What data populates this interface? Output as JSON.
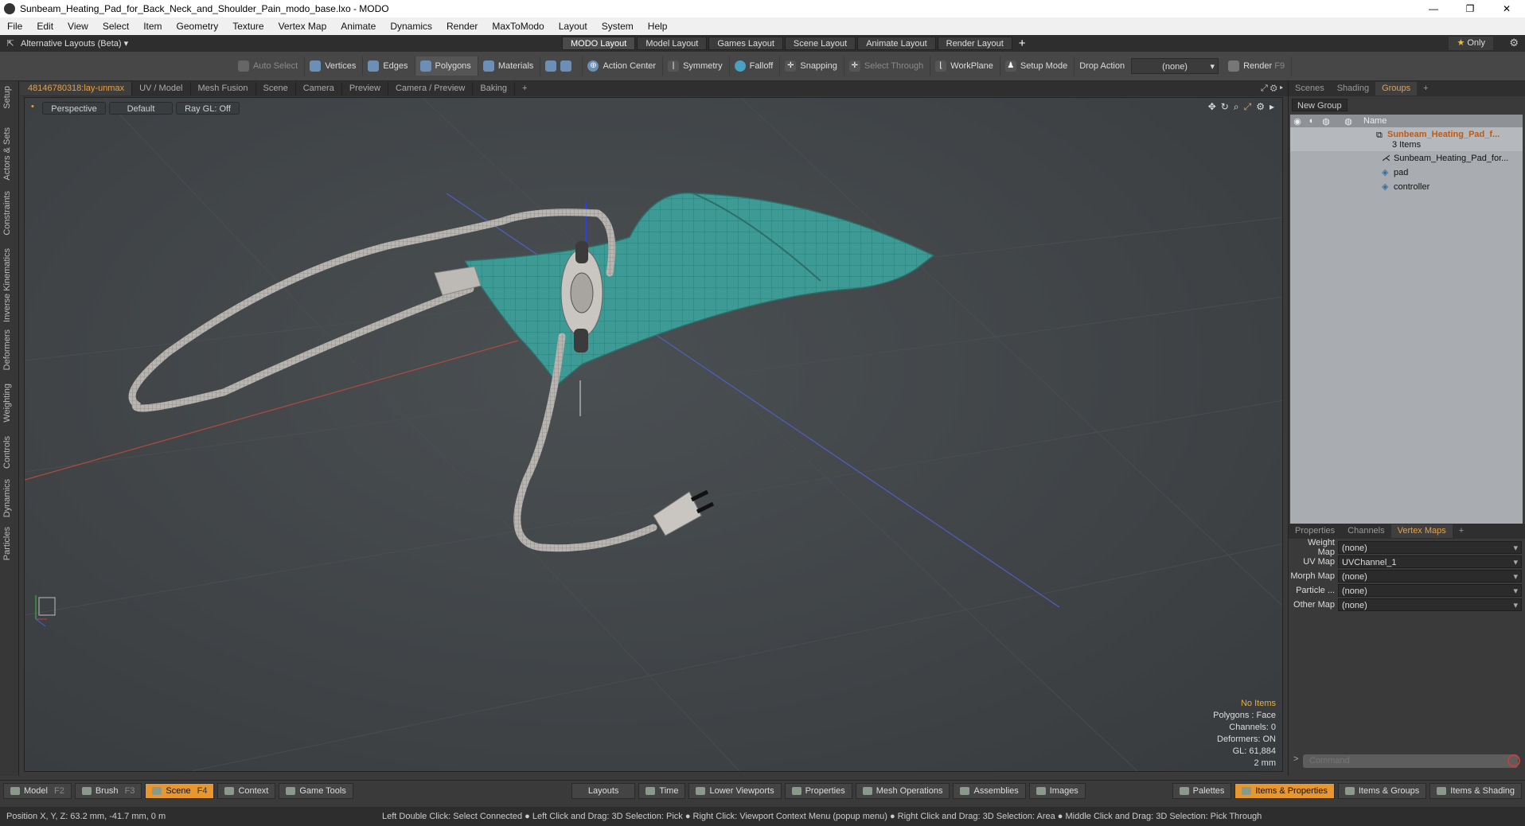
{
  "window": {
    "title": "Sunbeam_Heating_Pad_for_Back_Neck_and_Shoulder_Pain_modo_base.lxo - MODO",
    "minimize": "—",
    "maximize": "❐",
    "close": "✕"
  },
  "menu": [
    "File",
    "Edit",
    "View",
    "Select",
    "Item",
    "Geometry",
    "Texture",
    "Vertex Map",
    "Animate",
    "Dynamics",
    "Render",
    "MaxToModo",
    "Layout",
    "System",
    "Help"
  ],
  "layouts": {
    "switcher": "Alternative Layouts (Beta)",
    "tabs": [
      "MODO Layout",
      "Model Layout",
      "Games Layout",
      "Scene Layout",
      "Animate Layout",
      "Render Layout"
    ],
    "add": "+",
    "only": "Only"
  },
  "toolbar": {
    "auto_select": "Auto Select",
    "vertices": "Vertices",
    "edges": "Edges",
    "polygons": "Polygons",
    "materials": "Materials",
    "action_center": "Action Center",
    "symmetry": "Symmetry",
    "falloff": "Falloff",
    "snapping": "Snapping",
    "select_through": "Select Through",
    "workplane": "WorkPlane",
    "setup_mode": "Setup Mode",
    "drop_action": "Drop Action",
    "drop_value": "(none)",
    "render": "Render",
    "render_key": "F9"
  },
  "left_tabs": [
    "Setup",
    "Actors & Sets",
    "Constraints",
    "Inverse Kinematics",
    "Deformers",
    "Weighting",
    "Controls",
    "Dynamics",
    "Particles"
  ],
  "viewport_tabs": [
    "48146780318:lay-unmax",
    "UV / Model",
    "Mesh Fusion",
    "Scene",
    "Camera",
    "Preview",
    "Camera / Preview",
    "Baking",
    "+"
  ],
  "viewport": {
    "projection": "Perspective",
    "shading": "Default",
    "raygl": "Ray GL: Off",
    "stats": {
      "items": "No Items",
      "polygons": "Polygons : Face",
      "channels": "Channels: 0",
      "deformers": "Deformers: ON",
      "gl": "GL: 61,884",
      "unit": "2 mm"
    }
  },
  "scene_panel": {
    "tabs": [
      "Scenes",
      "Shading",
      "Groups",
      "+"
    ],
    "new_group": "New Group",
    "col_name": "Name",
    "group_name": "Sunbeam_Heating_Pad_f...",
    "group_count": "3 Items",
    "children": [
      "Sunbeam_Heating_Pad_for...",
      "pad",
      "controller"
    ]
  },
  "props_panel": {
    "tabs": [
      "Properties",
      "Channels",
      "Vertex Maps",
      "+"
    ],
    "rows": [
      {
        "label": "Weight Map",
        "value": "(none)"
      },
      {
        "label": "UV Map",
        "value": "UVChannel_1"
      },
      {
        "label": "Morph Map",
        "value": "(none)"
      },
      {
        "label": "Particle ...",
        "value": "(none)"
      },
      {
        "label": "Other Map",
        "value": "(none)"
      }
    ],
    "command_placeholder": "Command"
  },
  "bottom": {
    "left": [
      {
        "label": "Model",
        "key": "F2"
      },
      {
        "label": "Brush",
        "key": "F3"
      },
      {
        "label": "Scene",
        "key": "F4"
      },
      {
        "label": "Context",
        "key": ""
      },
      {
        "label": "Game Tools",
        "key": ""
      }
    ],
    "center": [
      "Layouts",
      "Time",
      "Lower Viewports",
      "Properties",
      "Mesh Operations",
      "Assemblies",
      "Images"
    ],
    "right": [
      "Palettes",
      "Items & Properties",
      "Items & Groups",
      "Items & Shading"
    ]
  },
  "status": {
    "position": "Position X, Y, Z:  63.2 mm, -41.7 mm, 0 m",
    "hint": "Left Double Click: Select Connected ● Left Click and Drag: 3D Selection: Pick ● Right Click: Viewport Context Menu (popup menu) ● Right Click and Drag: 3D Selection: Area ● Middle Click and Drag: 3D Selection: Pick Through"
  },
  "colors": {
    "accent": "#e8a040",
    "pad": "#3e9a94",
    "cord": "#b8b4b0"
  }
}
